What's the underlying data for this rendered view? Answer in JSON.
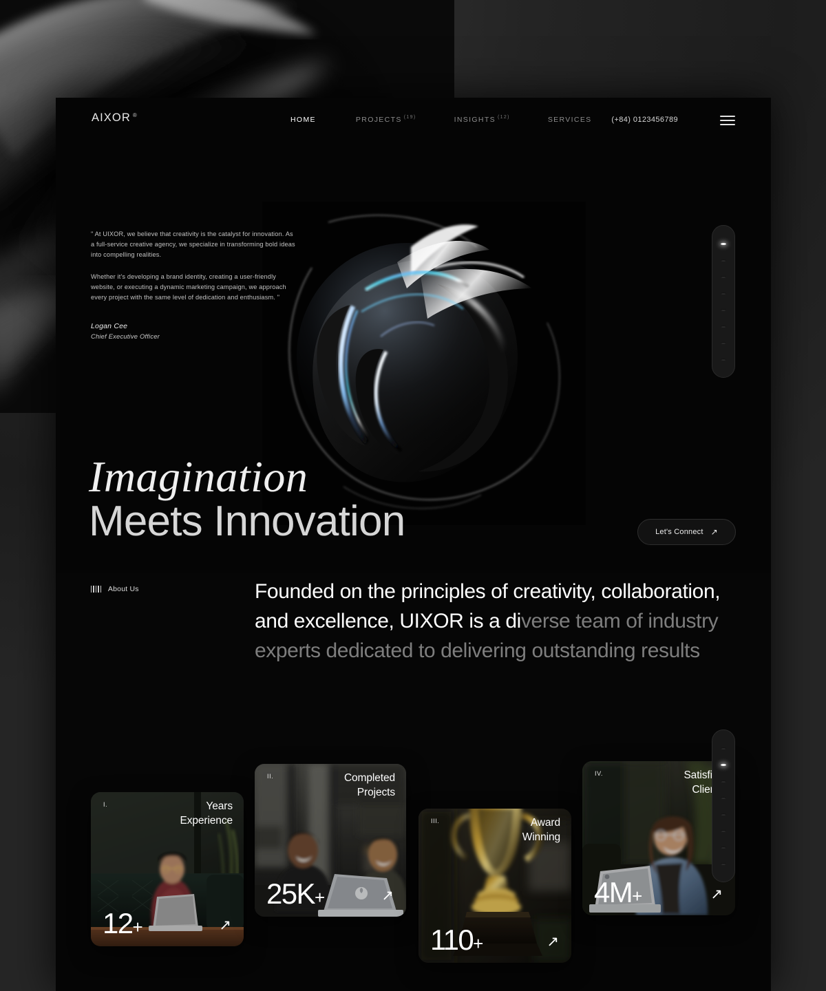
{
  "brand": {
    "name": "AIXOR",
    "registered": "®"
  },
  "nav": {
    "items": [
      {
        "label": "HOME",
        "count": "",
        "active": true
      },
      {
        "label": "PROJECTS",
        "count": "(19)",
        "active": false
      },
      {
        "label": "INSIGHTS",
        "count": "(12)",
        "active": false
      },
      {
        "label": "SERVICES",
        "count": "",
        "active": false
      }
    ],
    "phone": "(+84) 0123456789",
    "menu_icon": "hamburger-icon"
  },
  "hero": {
    "quote_paragraph_1": "\" At UIXOR, we believe that creativity is the catalyst for innovation. As a full-service creative agency, we specialize in transforming bold ideas into compelling realities.",
    "quote_paragraph_2": "Whether it's developing a brand identity, creating a user-friendly website, or executing a dynamic marketing campaign, we approach every project with the same level of dedication and enthusiasm. \"",
    "author_name": "Logan Cee",
    "author_role": "Chief Executive Officer",
    "headline_line1": "Imagination",
    "headline_line2": "Meets Innovation",
    "cta_label": "Let's Connect",
    "cta_icon": "arrow-up-right-icon"
  },
  "scroll_indicator_top": {
    "total_dots": 8,
    "active_index": 0
  },
  "scroll_indicator_bottom": {
    "total_dots": 8,
    "active_index": 1
  },
  "about": {
    "tag_icon": "barcode-icon",
    "tag_label": "About Us",
    "text_highlight": "Founded on the principles of creativity, collaboration, and excellence, UIXOR is a di",
    "text_muted": "verse team of industry experts dedicated to delivering outstanding results"
  },
  "stats": [
    {
      "index": "I.",
      "title": "Years\nExperience",
      "value": "12",
      "suffix": "+",
      "link_icon": "arrow-up-right-icon",
      "photo": "woman-with-laptop-on-dark-leather-couch"
    },
    {
      "index": "II.",
      "title": "Completed\nProjects",
      "value": "25K",
      "suffix": "+",
      "link_icon": "arrow-up-right-icon",
      "photo": "two-men-smiling-at-laptop-in-cafe"
    },
    {
      "index": "III.",
      "title": "Award\nWinning",
      "value": "110",
      "suffix": "+",
      "link_icon": "arrow-up-right-icon",
      "photo": "golden-trophy-close-up"
    },
    {
      "index": "IV.",
      "title": "Satisfied\nClients",
      "value": "4M",
      "suffix": "+",
      "link_icon": "arrow-up-right-icon",
      "photo": "woman-in-denim-jacket-with-laptop"
    }
  ],
  "colors": {
    "page_background": "#050505",
    "desktop_background": "#2b2b2b",
    "text_primary": "#fdfdfd",
    "text_muted": "#7d7d7d",
    "accent_glow": "#ffffff"
  }
}
